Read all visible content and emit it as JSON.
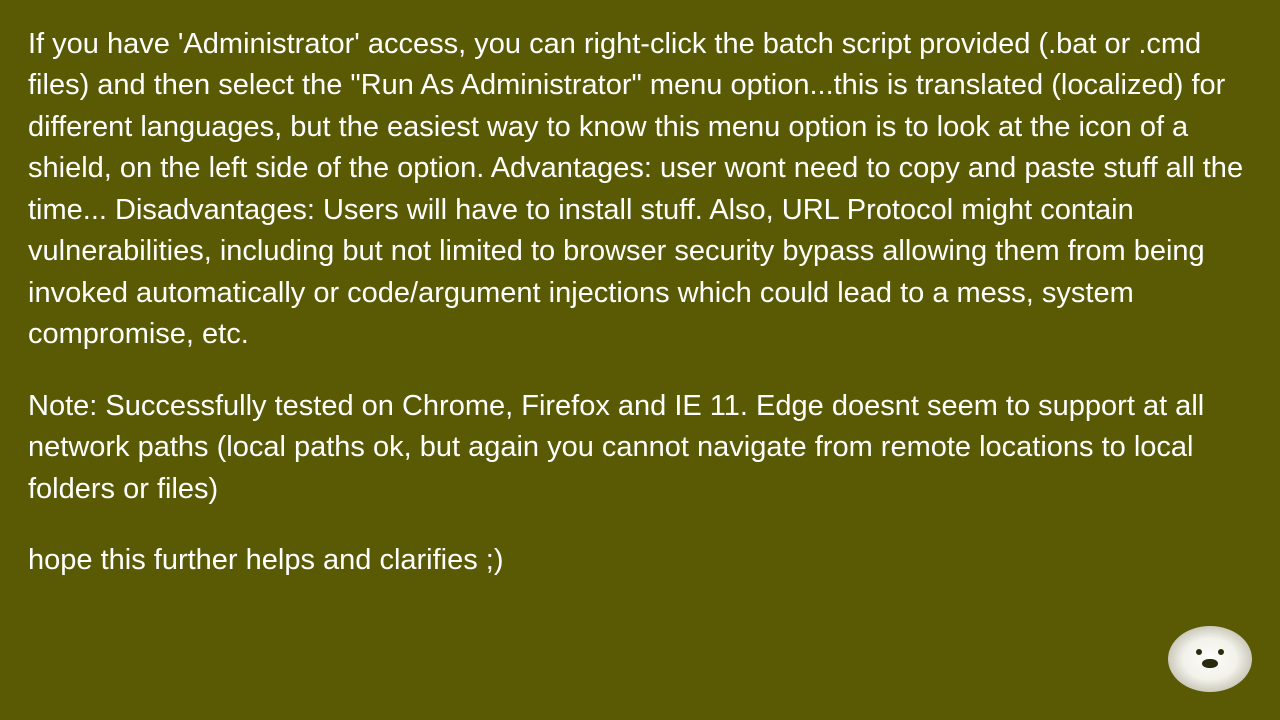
{
  "paragraphs": {
    "p1": "If you have 'Administrator' access, you can right-click the batch script provided (.bat or .cmd files) and then select the \"Run As Administrator\" menu option...this is translated (localized) for different languages, but the easiest way to know this menu option is to look at the icon of a shield, on the left side of the option. Advantages: user wont need to copy and paste stuff all the time... Disadvantages: Users will have to install stuff. Also, URL Protocol might contain vulnerabilities, including but not limited to browser security bypass allowing them from being invoked automatically or code/argument injections which could lead to a mess, system compromise, etc.",
    "p2": "Note: Successfully tested on Chrome, Firefox and IE 11. Edge doesnt seem to support at all network paths (local paths ok, but again you cannot navigate from remote locations to local folders or files)",
    "p3": "hope this further helps and clarifies ;)"
  }
}
